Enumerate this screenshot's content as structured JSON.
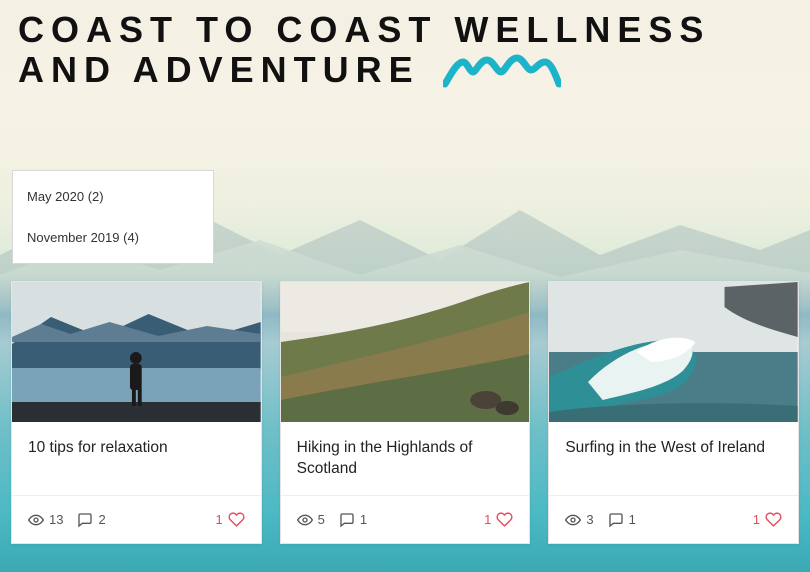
{
  "site": {
    "title": "Coast to Coast Wellness and Adventure"
  },
  "archive": [
    {
      "label": "May 2020 (2)"
    },
    {
      "label": "November 2019 (4)"
    }
  ],
  "posts": [
    {
      "title": "10 tips for relaxation",
      "views": "13",
      "comments": "2",
      "likes": "1"
    },
    {
      "title": "Hiking in the Highlands of Scotland",
      "views": "5",
      "comments": "1",
      "likes": "1"
    },
    {
      "title": "Surfing in the West of Ireland",
      "views": "3",
      "comments": "1",
      "likes": "1"
    }
  ]
}
